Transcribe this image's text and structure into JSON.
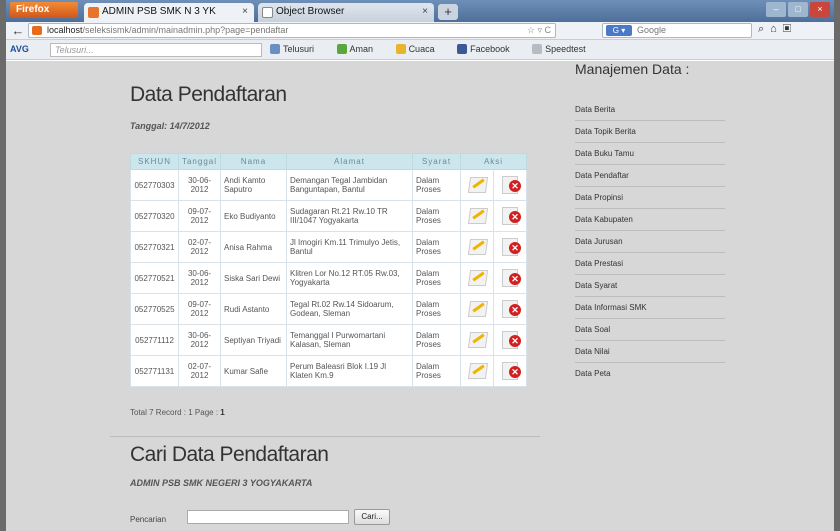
{
  "browser": {
    "firefox_button": "Firefox",
    "tabs": [
      {
        "title": "ADMIN PSB SMK N 3 YK",
        "active": true
      },
      {
        "title": "Object Browser",
        "active": false
      }
    ],
    "new_tab": "+",
    "close_tab": "×",
    "url_host": "localhost",
    "url_path": "/seleksismk/admin/mainadmin.php?page=pendaftar",
    "search_engine": "Google",
    "search_placeholder": "Google"
  },
  "avg_toolbar": {
    "logo": "AVG",
    "search_placeholder": "Telusuri...",
    "items": [
      "Telusuri",
      "Aman",
      "Cuaca",
      "Facebook",
      "Speedtest"
    ]
  },
  "main": {
    "title": "Data Pendaftaran",
    "date_label": "Tanggal: 14/7/2012",
    "table": {
      "headers": [
        "SKHUN",
        "Tanggal",
        "Nama",
        "Alamat",
        "Syarat",
        "Aksi"
      ],
      "rows": [
        {
          "skhun": "052770303",
          "tanggal": "30-06-2012",
          "nama": "Andi Kamto Saputro",
          "alamat": "Demangan Tegal Jambidan Banguntapan, Bantul",
          "syarat": "Dalam Proses"
        },
        {
          "skhun": "052770320",
          "tanggal": "09-07-2012",
          "nama": "Eko Budiyanto",
          "alamat": "Sudagaran Rt.21 Rw.10 TR III/1047 Yogyakarta",
          "syarat": "Dalam Proses"
        },
        {
          "skhun": "052770321",
          "tanggal": "02-07-2012",
          "nama": "Anisa Rahma",
          "alamat": "Jl Imogiri Km.11 Trimulyo Jetis, Bantul",
          "syarat": "Dalam Proses"
        },
        {
          "skhun": "052770521",
          "tanggal": "30-06-2012",
          "nama": "Siska Sari Dewi",
          "alamat": "Klitren Lor No.12 RT.05 Rw.03, Yogyakarta",
          "syarat": "Dalam Proses"
        },
        {
          "skhun": "052770525",
          "tanggal": "09-07-2012",
          "nama": "Rudi Astanto",
          "alamat": "Tegal Rt.02 Rw.14 Sidoarum, Godean, Sleman",
          "syarat": "Dalam Proses"
        },
        {
          "skhun": "052771112",
          "tanggal": "30-06-2012",
          "nama": "Septiyan Triyadi",
          "alamat": "Temanggal I Purwomartani Kalasan, Sleman",
          "syarat": "Dalam Proses"
        },
        {
          "skhun": "052771131",
          "tanggal": "02-07-2012",
          "nama": "Kumar Safie",
          "alamat": "Perum Baleasri Blok I.19 Jl Klaten Km.9",
          "syarat": "Dalam Proses"
        }
      ]
    },
    "total_text": "Total 7 Record : 1 Page : ",
    "total_page": "1",
    "search_title": "Cari Data Pendaftaran",
    "search_subtitle": "ADMIN PSB SMK NEGERI 3 YOGYAKARTA",
    "search_label": "Pencarian",
    "search_button": "Cari..."
  },
  "sidebar": {
    "title": "Manajemen Data :",
    "items": [
      "Data Berita",
      "Data Topik Berita",
      "Data Buku Tamu",
      "Data Pendaftar",
      "Data Propinsi",
      "Data Kabupaten",
      "Data Jurusan",
      "Data Prestasi",
      "Data Syarat",
      "Data Informasi SMK",
      "Data Soal",
      "Data Nilai",
      "Data Peta"
    ]
  }
}
